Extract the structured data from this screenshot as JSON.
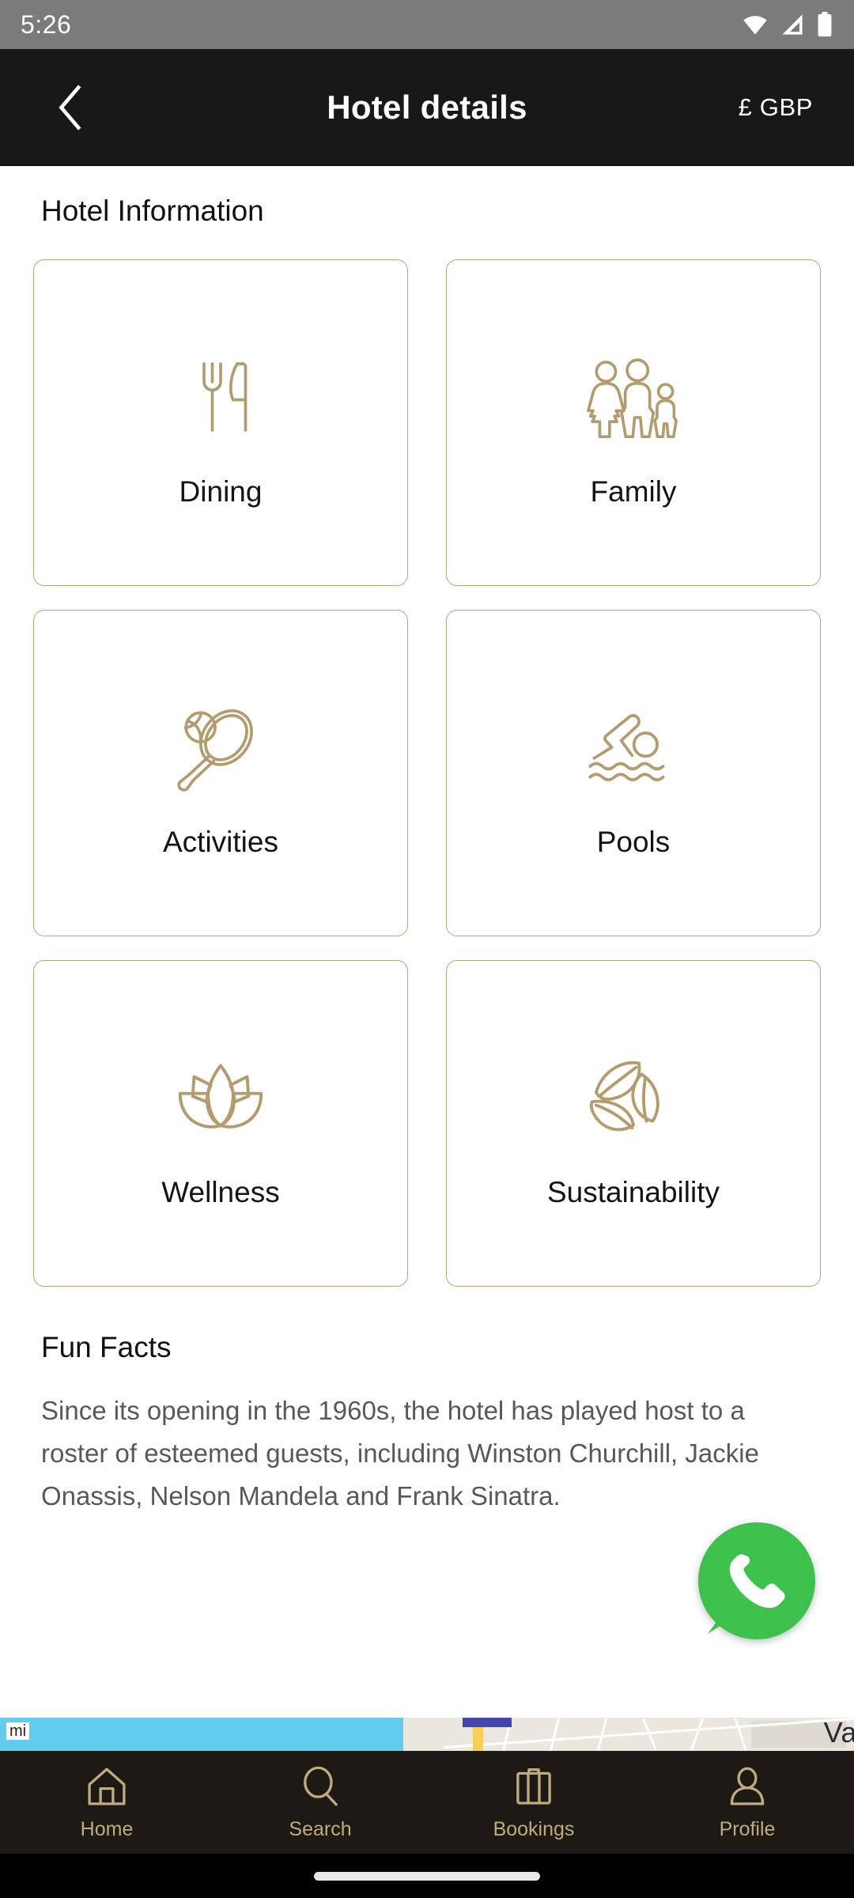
{
  "status_bar": {
    "time": "5:26",
    "icons": [
      "wifi-icon",
      "cellular-signal-icon",
      "battery-icon"
    ]
  },
  "header": {
    "back_icon": "chevron-left-icon",
    "title": "Hotel details",
    "currency": "£ GBP"
  },
  "main": {
    "section_title": "Hotel Information",
    "cards": [
      {
        "label": "Dining",
        "icon": "fork-and-knife-icon"
      },
      {
        "label": "Family",
        "icon": "family-group-icon"
      },
      {
        "label": "Activities",
        "icon": "tennis-racket-icon"
      },
      {
        "label": "Pools",
        "icon": "swimmer-icon"
      },
      {
        "label": "Wellness",
        "icon": "lotus-flower-icon"
      },
      {
        "label": "Sustainability",
        "icon": "leaves-recycle-icon"
      }
    ],
    "fun_facts": {
      "title": "Fun Facts",
      "body": "Since its opening in the 1960s, the hotel has played host to a roster of esteemed guests, including Winston Churchill, Jackie Onassis, Nelson Mandela and Frank Sinatra."
    }
  },
  "floating_action": {
    "name": "whatsapp-button",
    "icon": "whatsapp-phone-icon"
  },
  "map_strip": {
    "scale_unit": "mi",
    "partial_label": "Va"
  },
  "bottom_nav": {
    "items": [
      {
        "label": "Home",
        "icon": "house-icon"
      },
      {
        "label": "Search",
        "icon": "magnifier-icon"
      },
      {
        "label": "Bookings",
        "icon": "suitcase-icon"
      },
      {
        "label": "Profile",
        "icon": "person-icon"
      }
    ]
  },
  "colors": {
    "gold": "#b8a374",
    "nav_gold": "#c0ab7e",
    "header_bg": "#181818",
    "statusbar_bg": "#7b7b7b",
    "whatsapp_green": "#3dc14c",
    "body_text": "#585858"
  }
}
